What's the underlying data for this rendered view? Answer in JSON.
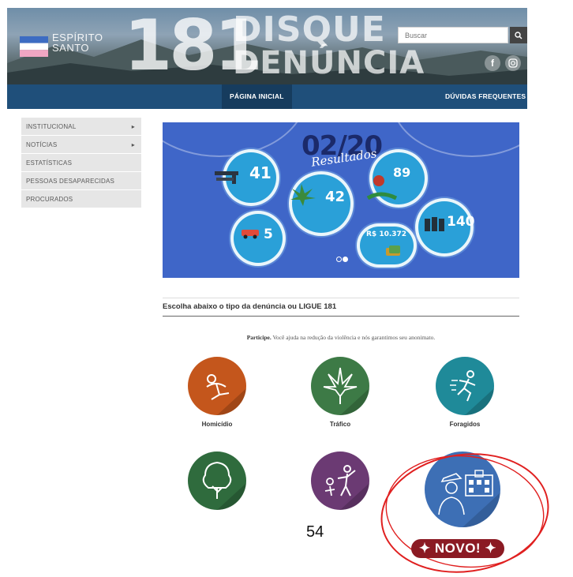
{
  "header": {
    "logo_line1": "Espírito",
    "logo_line2": "Santo",
    "big_number": "181",
    "title_line1": "DISQUE",
    "title_line2": "DENÚNCIA",
    "search_placeholder": "Buscar",
    "facebook_glyph": "f"
  },
  "nav": {
    "home": "Página Inicial",
    "faq": "Dúvidas Frequentes"
  },
  "sidebar": {
    "items": [
      {
        "label": "Institucional",
        "has_submenu": true
      },
      {
        "label": "Notícias",
        "has_submenu": true
      },
      {
        "label": "Estatísticas",
        "has_submenu": false
      },
      {
        "label": "Pessoas Desaparecidas",
        "has_submenu": false
      },
      {
        "label": "Procurados",
        "has_submenu": false
      }
    ]
  },
  "banner": {
    "title": "02/20",
    "subtitle": "Resultados",
    "stats": [
      "41",
      "42",
      "89",
      "5",
      "R$ 10.372",
      "140"
    ]
  },
  "section": {
    "title": "Escolha abaixo o tipo da denúncia ou LIGUE 181",
    "intro_bold": "Participe.",
    "intro_text": " Você ajuda na redução da violência e nós garantimos seu anonimato."
  },
  "categories": [
    {
      "label": "Homicídio",
      "color": "#c4561c",
      "icon": "homicide-icon"
    },
    {
      "label": "Tráfico",
      "color": "#3d7a46",
      "icon": "cannabis-leaf-icon"
    },
    {
      "label": "Foragidos",
      "color": "#1f8a99",
      "icon": "running-man-icon"
    },
    {
      "label": "",
      "color": "#2f6b3d",
      "icon": "tree-icon"
    },
    {
      "label": "",
      "color": "#6b3a73",
      "icon": "aggression-icon"
    },
    {
      "label": "",
      "color": "#3d6fb5",
      "icon": "school-guard-icon"
    }
  ],
  "page_number": "54",
  "badge": "✦ NOVO! ✦",
  "colors": {
    "nav_bg": "#1f4f7a",
    "banner_bg": "#3f66c8",
    "badge_bg": "#8b1a23",
    "highlight_ring": "#e02020"
  }
}
